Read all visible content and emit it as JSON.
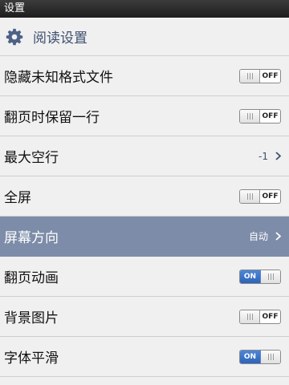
{
  "titlebar": {
    "title": "设置"
  },
  "header": {
    "title": "阅读设置",
    "icon": "gear-icon"
  },
  "rows": [
    {
      "label": "隐藏未知格式文件",
      "type": "toggle",
      "state": "OFF"
    },
    {
      "label": "翻页时保留一行",
      "type": "toggle",
      "state": "OFF"
    },
    {
      "label": "最大空行",
      "type": "value",
      "value": "-1"
    },
    {
      "label": "全屏",
      "type": "toggle",
      "state": "OFF"
    },
    {
      "label": "屏幕方向",
      "type": "value",
      "value": "自动",
      "selected": true
    },
    {
      "label": "翻页动画",
      "type": "toggle",
      "state": "ON"
    },
    {
      "label": "背景图片",
      "type": "toggle",
      "state": "OFF"
    },
    {
      "label": "字体平滑",
      "type": "toggle",
      "state": "ON"
    }
  ],
  "colors": {
    "accent": "#2d63b8",
    "selected_row": "#7d8ca8",
    "header_text": "#3e4f6e"
  }
}
